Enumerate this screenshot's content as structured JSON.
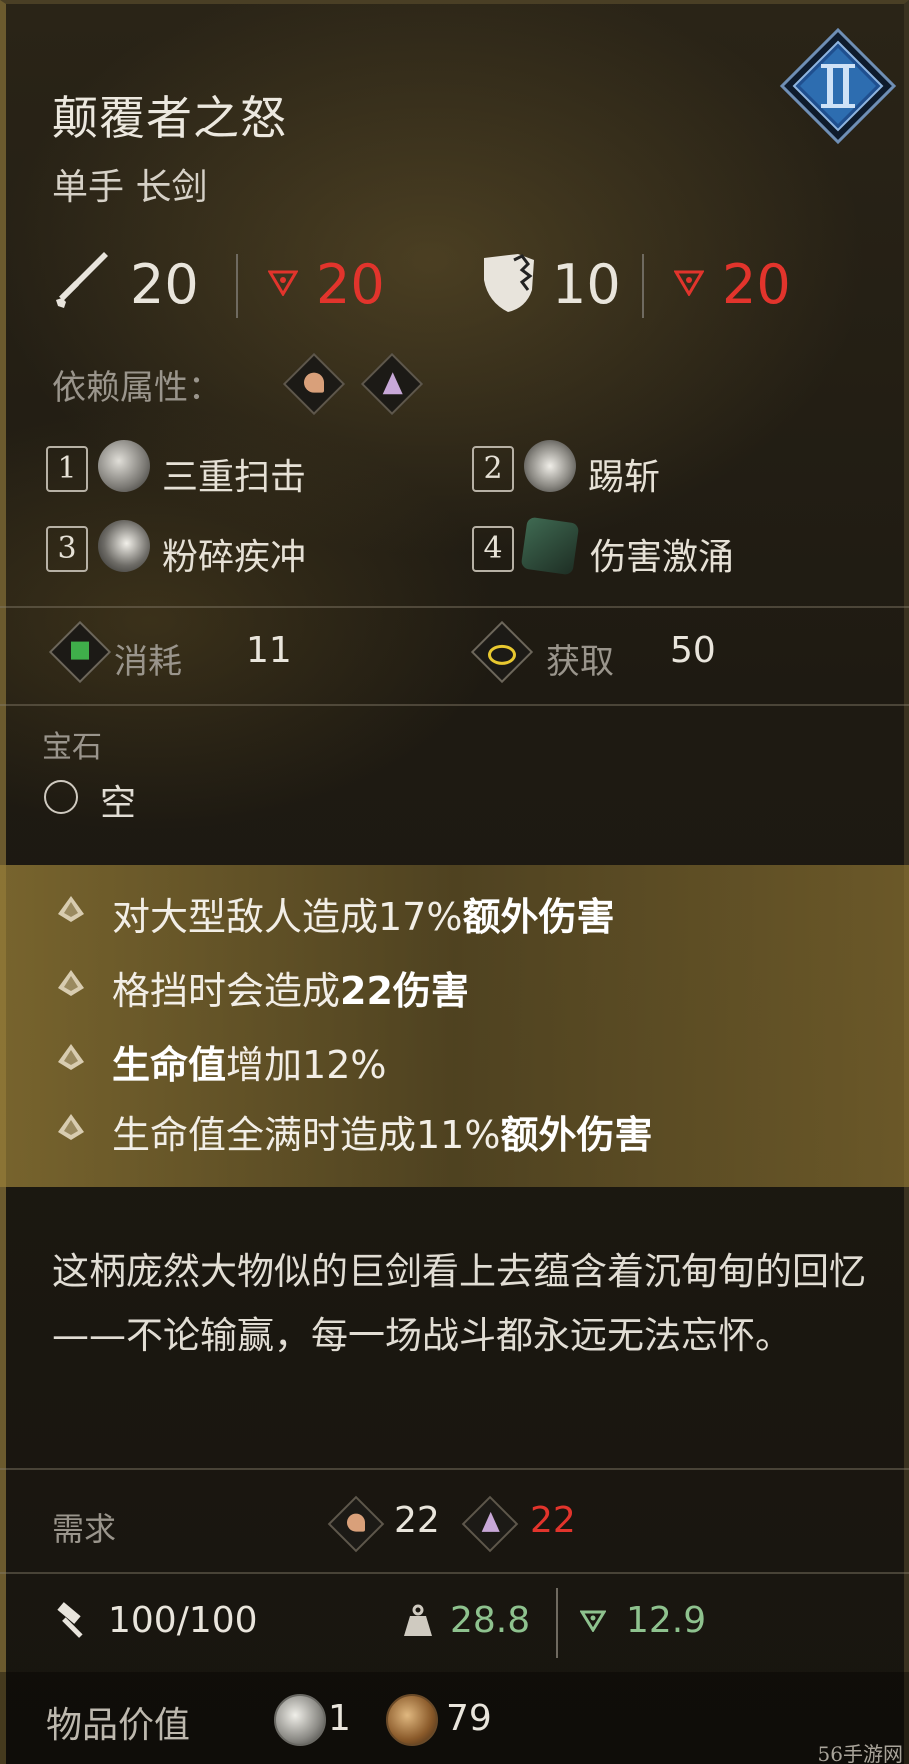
{
  "item": {
    "name": "颠覆者之怒",
    "type": "单手 长剑",
    "tier_icon": "roman-two-badge"
  },
  "stats": {
    "attack": "20",
    "attack_penalty": "20",
    "defense": "10",
    "defense_penalty": "20"
  },
  "scaling": {
    "label": "依赖属性：",
    "icons": [
      "strength-arm-icon",
      "faith-hands-icon"
    ]
  },
  "skills": [
    {
      "num": "1",
      "name": "三重扫击"
    },
    {
      "num": "2",
      "name": "踢斩"
    },
    {
      "num": "3",
      "name": "粉碎疾冲"
    },
    {
      "num": "4",
      "name": "伤害激涌"
    }
  ],
  "resources": {
    "cost_label": "消耗",
    "cost_value": "11",
    "gain_label": "获取",
    "gain_value": "50"
  },
  "gem": {
    "label": "宝石",
    "slot": "空"
  },
  "attributes": [
    {
      "pre": "对大型敌人造成17%",
      "bold": "额外伤害",
      "post": ""
    },
    {
      "pre": "格挡时会造成",
      "bold": "22伤害",
      "post": ""
    },
    {
      "pre": "",
      "bold": "生命值",
      "post": "增加12%"
    },
    {
      "pre": "生命值全满时造成11%",
      "bold": "额外伤害",
      "post": ""
    }
  ],
  "description": "这柄庞然大物似的巨剑看上去蕴含着沉甸甸的回忆——不论输赢，每一场战斗都永远无法忘怀。",
  "requirements": {
    "label": "需求",
    "strength": "22",
    "faith": "22"
  },
  "durability": "100/100",
  "weight": "28.8",
  "weight_penalty": "12.9",
  "value": {
    "label": "物品价值",
    "silver": "1",
    "gold": "79"
  },
  "watermark": "56手游网",
  "colors": {
    "penalty": "#e2342c",
    "accent_gold": "#b59a4a",
    "tier_blue": "#2d6db0"
  }
}
